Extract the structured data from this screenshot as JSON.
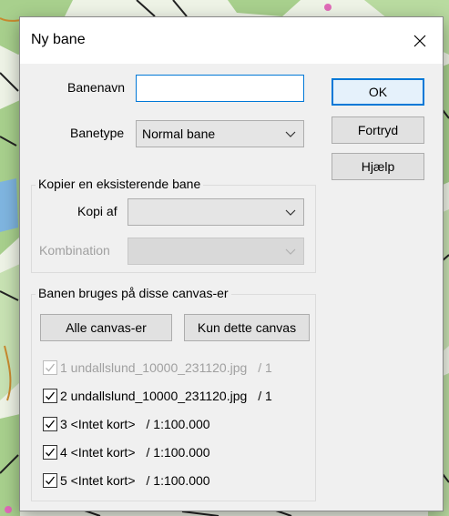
{
  "dialog": {
    "title": "Ny bane",
    "close_icon": "close-icon"
  },
  "form": {
    "course_name_label": "Banenavn",
    "course_name_value": "",
    "course_type_label": "Banetype",
    "course_type_value": "Normal bane"
  },
  "buttons": {
    "ok": "OK",
    "cancel": "Fortryd",
    "help": "Hjælp"
  },
  "copy_group": {
    "title": "Kopier en eksisterende bane",
    "copy_of_label": "Kopi af",
    "copy_of_value": "",
    "combination_label": "Kombination",
    "combination_value": ""
  },
  "canvas_group": {
    "title": "Banen bruges på disse canvas-er",
    "all_button": "Alle canvas-er",
    "only_this_button": "Kun dette canvas",
    "items": [
      {
        "label": "1 undallslund_10000_231120.jpg",
        "scale": "/ 1",
        "checked": true,
        "enabled": false
      },
      {
        "label": "2 undallslund_10000_231120.jpg",
        "scale": "/ 1",
        "checked": true,
        "enabled": true
      },
      {
        "label": "3 <Intet kort>",
        "scale": "/ 1:100.000",
        "checked": true,
        "enabled": true
      },
      {
        "label": "4 <Intet kort>",
        "scale": "/ 1:100.000",
        "checked": true,
        "enabled": true
      },
      {
        "label": "5 <Intet kort>",
        "scale": "/ 1:100.000",
        "checked": true,
        "enabled": true
      }
    ]
  },
  "colors": {
    "accent": "#0078d7",
    "dialog_bg": "#f0f0f0",
    "disabled_text": "#a0a0a0"
  }
}
